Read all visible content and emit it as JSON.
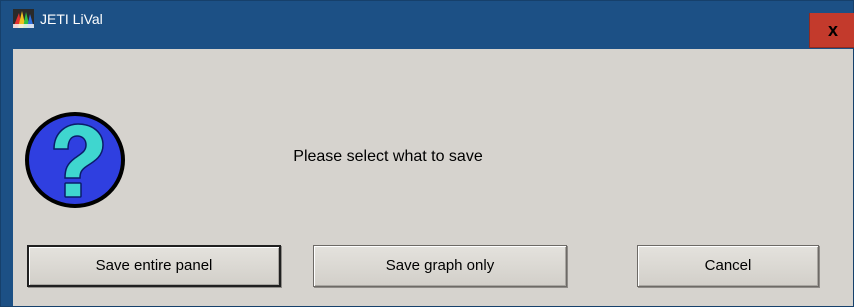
{
  "window": {
    "title": "JETI LiVal",
    "close_label": "x",
    "icon": "jeti-app-icon",
    "colors": {
      "titlebar": "#1c5085",
      "close": "#c33a2c",
      "client": "#d6d3ce",
      "question_icon_fill": "#2f3fe0",
      "question_mark": "#3fd6cf"
    }
  },
  "dialog": {
    "icon": "question-icon",
    "message": "Please select what to save",
    "buttons": {
      "save_entire_panel": "Save entire panel",
      "save_graph_only": "Save graph only",
      "cancel": "Cancel"
    }
  }
}
